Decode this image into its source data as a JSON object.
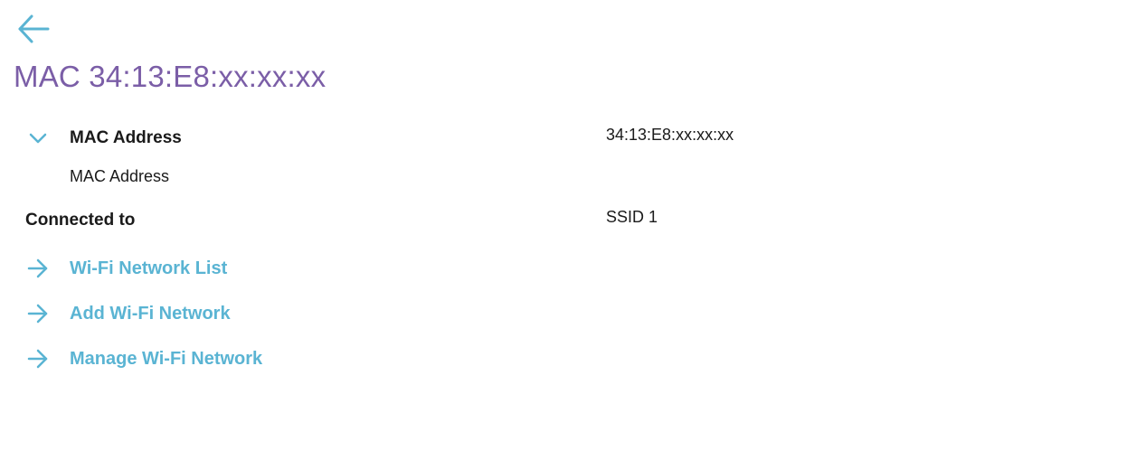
{
  "header": {
    "back_icon": "arrow-left-icon",
    "title": "MAC 34:13:E8:xx:xx:xx"
  },
  "details": {
    "mac_section": {
      "expand_icon": "chevron-down-icon",
      "label": "MAC Address",
      "sub_label": "MAC Address",
      "value": "34:13:E8:xx:xx:xx"
    },
    "connected": {
      "label": "Connected to",
      "value": "SSID 1"
    }
  },
  "links": [
    {
      "label": "Wi-Fi Network List",
      "icon": "arrow-right-icon"
    },
    {
      "label": "Add Wi-Fi Network",
      "icon": "arrow-right-icon"
    },
    {
      "label": "Manage Wi-Fi Network",
      "icon": "arrow-right-icon"
    }
  ],
  "colors": {
    "accent": "#5ab4d3",
    "title": "#7b5ea7",
    "text": "#1a1a1a"
  }
}
